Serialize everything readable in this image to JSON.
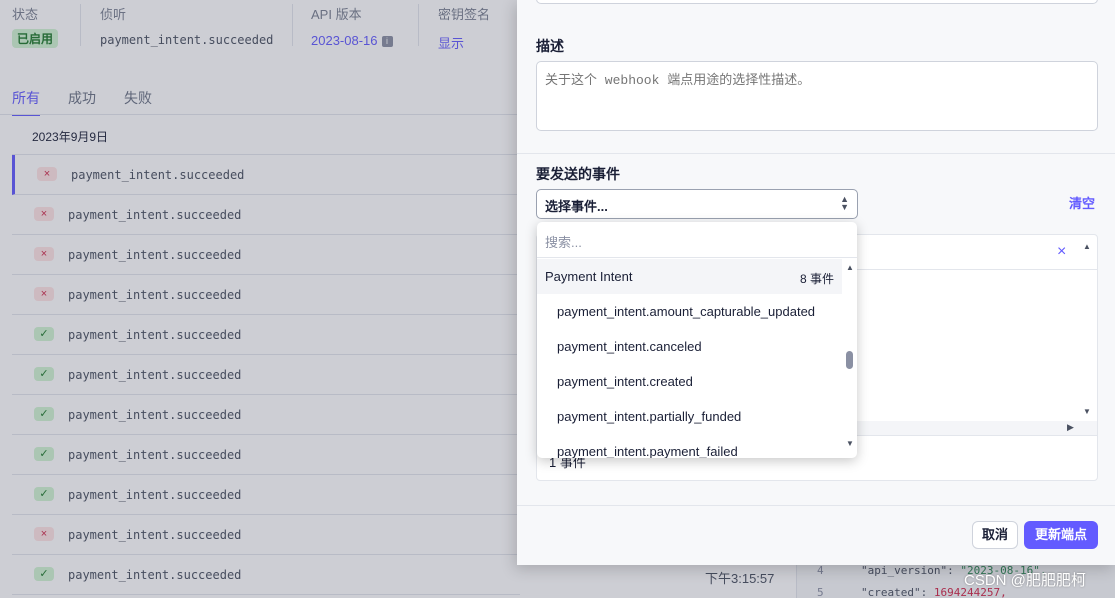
{
  "header": {
    "status_label": "状态",
    "status_value": "已启用",
    "listen_label": "侦听",
    "listen_value": "payment_intent.succeeded",
    "api_label": "API 版本",
    "api_value": "2023-08-16",
    "api_info": "i",
    "secret_label": "密钥签名",
    "secret_value": "显示"
  },
  "tabs": [
    {
      "label": "所有",
      "active": true
    },
    {
      "label": "成功",
      "active": false
    },
    {
      "label": "失败",
      "active": false
    }
  ],
  "date_header": "2023年9月9日",
  "events": [
    {
      "status": "fail",
      "status_icon": "×",
      "name": "payment_intent.succeeded"
    },
    {
      "status": "fail",
      "status_icon": "×",
      "name": "payment_intent.succeeded"
    },
    {
      "status": "fail",
      "status_icon": "×",
      "name": "payment_intent.succeeded"
    },
    {
      "status": "fail",
      "status_icon": "×",
      "name": "payment_intent.succeeded"
    },
    {
      "status": "ok",
      "status_icon": "✓",
      "name": "payment_intent.succeeded"
    },
    {
      "status": "ok",
      "status_icon": "✓",
      "name": "payment_intent.succeeded"
    },
    {
      "status": "ok",
      "status_icon": "✓",
      "name": "payment_intent.succeeded"
    },
    {
      "status": "ok",
      "status_icon": "✓",
      "name": "payment_intent.succeeded"
    },
    {
      "status": "ok",
      "status_icon": "✓",
      "name": "payment_intent.succeeded"
    },
    {
      "status": "fail",
      "status_icon": "×",
      "name": "payment_intent.succeeded"
    },
    {
      "status": "ok",
      "status_icon": "✓",
      "name": "payment_intent.succeeded"
    }
  ],
  "last_time": "下午3:15:57",
  "code": {
    "line4_no": "4",
    "line4_key": "\"api_version\": ",
    "line4_val": "\"2023-08-16\",",
    "line5_no": "5",
    "line5_key": "\"created\": ",
    "line5_val": "1694244257,"
  },
  "modal": {
    "description_label": "描述",
    "description_placeholder": "关于这个 webhook 端点用途的选择性描述。",
    "events_label": "要发送的事件",
    "select_label": "选择事件...",
    "clear_label": "清空",
    "close_glyph": "×",
    "selected_count": "1 事件",
    "cancel_label": "取消",
    "submit_label": "更新端点"
  },
  "dropdown": {
    "search_placeholder": "搜索...",
    "group_name": "Payment Intent",
    "group_count": "8 事件",
    "items": [
      "payment_intent.amount_capturable_updated",
      "payment_intent.canceled",
      "payment_intent.created",
      "payment_intent.partially_funded",
      "payment_intent.payment_failed"
    ]
  },
  "watermark": "CSDN @肥肥肥柯",
  "colors": {
    "accent": "#635bff",
    "success_bg": "#d1f5d3",
    "fail_bg": "#ffe5e5"
  }
}
